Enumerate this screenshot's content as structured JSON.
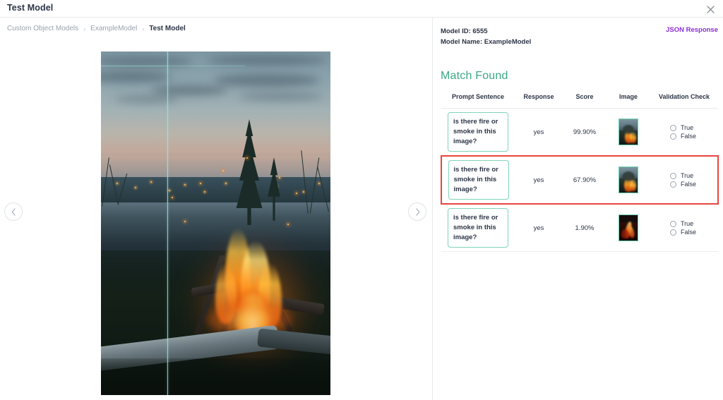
{
  "window": {
    "title": "Test Model",
    "close_icon": "close-icon"
  },
  "breadcrumb": {
    "separator": "›",
    "items": [
      {
        "label": "Custom Object Models",
        "current": false
      },
      {
        "label": "ExampleModel",
        "current": false
      },
      {
        "label": "Test Model",
        "current": true
      }
    ]
  },
  "viewer": {
    "prev_icon": "chevron-left-icon",
    "next_icon": "chevron-right-icon",
    "image_alt": "campfire-burning-at-dusk-overlooking-valley",
    "slider_position_pct": 29
  },
  "results": {
    "model_id_label": "Model ID:",
    "model_id_value": "6555",
    "model_name_label": "Model Name:",
    "model_name_value": "ExampleModel",
    "json_link": "JSON Response",
    "match_title": "Match Found",
    "accent_green": "#3aa882",
    "accent_purple": "#8b2ed6",
    "highlight_red": "#e8453c",
    "prompt_border": "#7fd4b8",
    "columns": [
      "Prompt Sentence",
      "Response",
      "Score",
      "Image",
      "Validation Check"
    ],
    "validation_options": [
      "True",
      "False"
    ],
    "rows": [
      {
        "prompt": "is there fire or smoke in this image?",
        "response": "yes",
        "score": "99.90%",
        "thumb": "campfire-thumb-light",
        "highlighted": false
      },
      {
        "prompt": "is there fire or smoke in this image?",
        "response": "yes",
        "score": "67.90%",
        "thumb": "campfire-thumb-light",
        "highlighted": true
      },
      {
        "prompt": "is there fire or smoke in this image?",
        "response": "yes",
        "score": "1.90%",
        "thumb": "campfire-thumb-dark",
        "highlighted": false
      }
    ]
  }
}
